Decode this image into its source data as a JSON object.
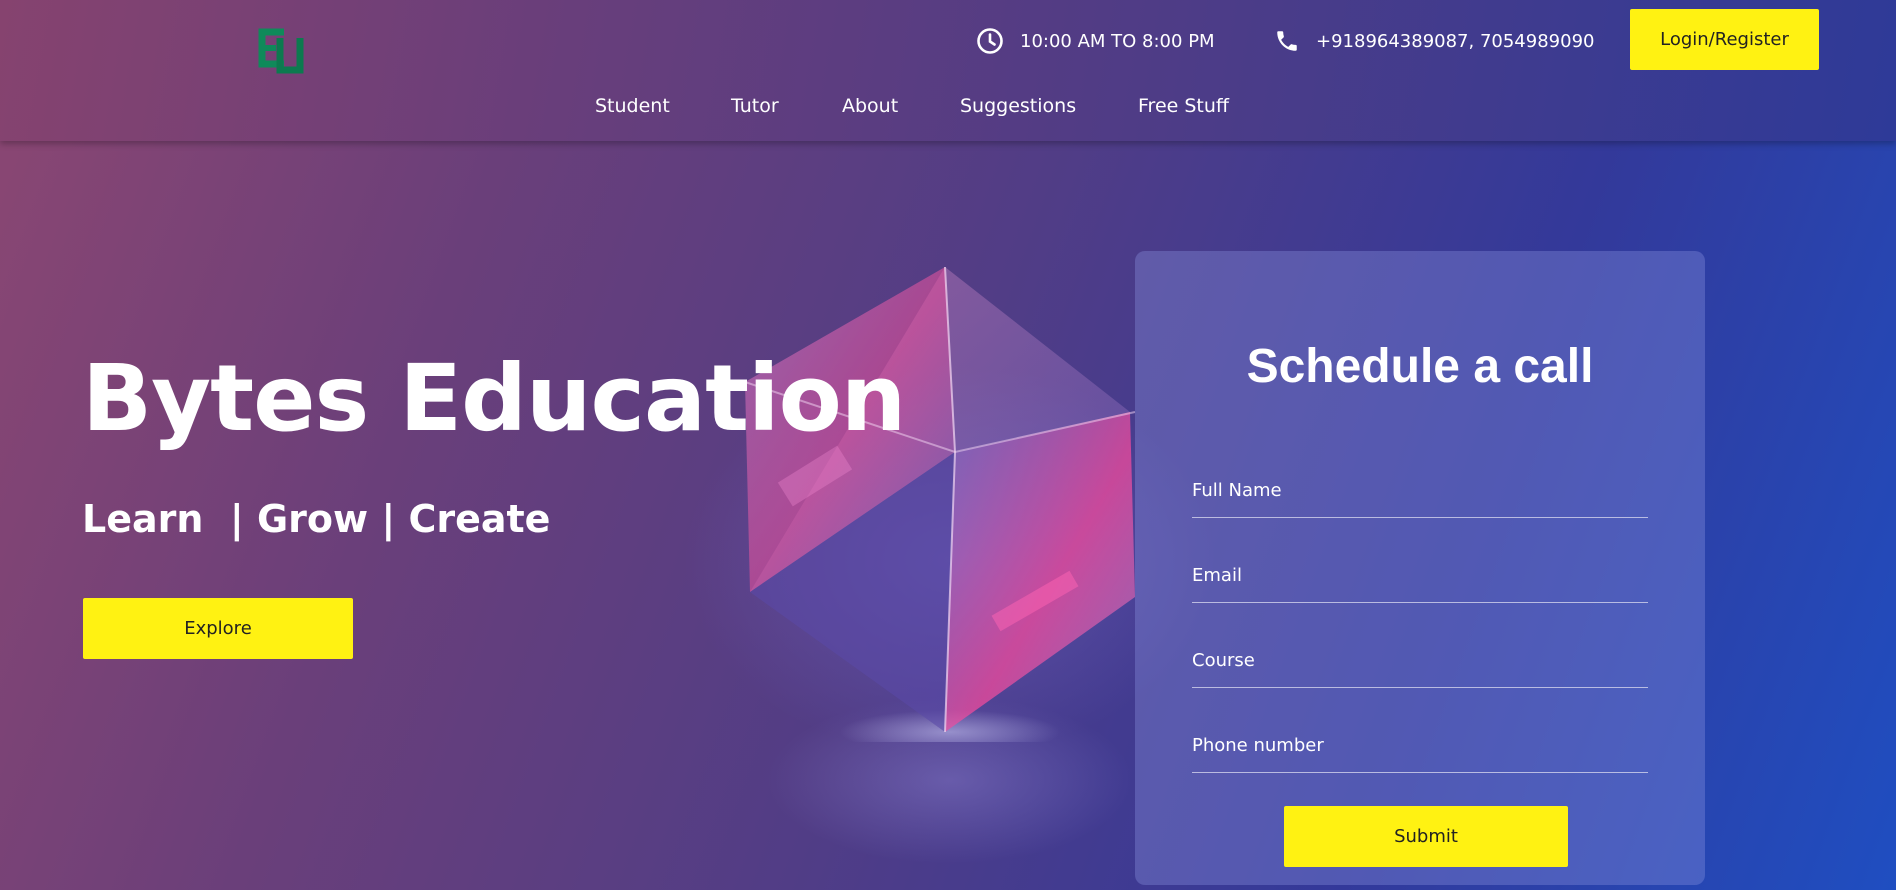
{
  "header": {
    "hours": "10:00 AM TO 8:00 PM",
    "phone": "+918964389087, 7054989090",
    "login_label": "Login/Register",
    "nav": [
      {
        "label": "Student"
      },
      {
        "label": "Tutor"
      },
      {
        "label": "About"
      },
      {
        "label": "Suggestions"
      },
      {
        "label": "Free Stuff"
      }
    ]
  },
  "hero": {
    "title": "Bytes Education",
    "tagline": "Learn  | Grow | Create",
    "explore_label": "Explore"
  },
  "form": {
    "title": "Schedule a call",
    "fields": [
      {
        "placeholder": "Full Name"
      },
      {
        "placeholder": "Email"
      },
      {
        "placeholder": "Course"
      },
      {
        "placeholder": "Phone number"
      }
    ],
    "submit_label": "Submit"
  },
  "icons": {
    "logo": "bytes-education-logo",
    "clock": "clock-icon",
    "phone": "phone-icon"
  },
  "colors": {
    "accent": "#fff212",
    "logo_green": "#0f8a5a"
  }
}
